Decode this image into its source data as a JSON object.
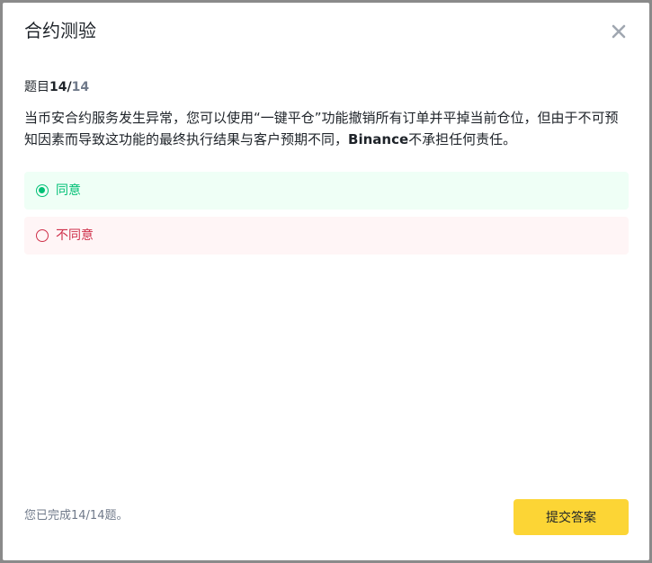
{
  "modal": {
    "title": "合约测验",
    "close_icon": "close-icon"
  },
  "progress": {
    "prefix": "题目",
    "current": "14/",
    "total": "14"
  },
  "question": {
    "text_before": "当币安合约服务发生异常，您可以使用“一键平仓”功能撤销所有订单并平掉当前仓位，但由于不可预知因素而导致这功能的最终执行结果与客户预期不同，",
    "brand": "Binance",
    "text_after": "不承担任何责任。"
  },
  "options": [
    {
      "label": "同意",
      "selected": true,
      "color": "#02c076"
    },
    {
      "label": "不同意",
      "selected": false,
      "color": "#cf304a"
    }
  ],
  "footer": {
    "completion_text": "您已完成14/14题。",
    "submit_label": "提交答案"
  },
  "colors": {
    "accent": "#fcd535",
    "success": "#02c076",
    "danger": "#cf304a"
  }
}
